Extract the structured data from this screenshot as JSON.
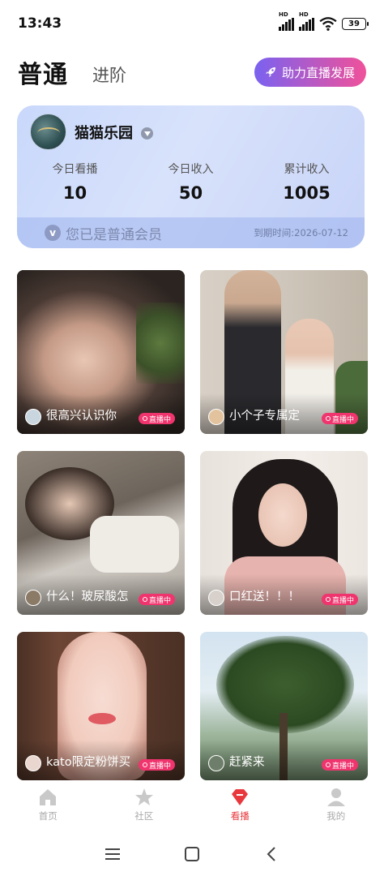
{
  "status_bar": {
    "time": "13:43",
    "battery": "39",
    "signal_label": "HD"
  },
  "header": {
    "tab_primary": "普通",
    "tab_secondary": "进阶",
    "boost_button": "助力直播发展"
  },
  "member_card": {
    "username": "猫猫乐园",
    "stats": [
      {
        "label": "今日看播",
        "value": "10"
      },
      {
        "label": "今日收入",
        "value": "50"
      },
      {
        "label": "累计收入",
        "value": "1005"
      }
    ],
    "member_status": "您已是普通会员",
    "member_icon_letter": "v",
    "expire_text": "到期时间:2026-07-12"
  },
  "live_badge_label": "直播中",
  "streams": [
    {
      "title": "很高兴认识你",
      "live": "直播中"
    },
    {
      "title": "小个子专属定",
      "live": "直播中"
    },
    {
      "title": "什么！玻尿酸怎",
      "live": "直播中"
    },
    {
      "title": "口红送！！！",
      "live": "直播中"
    },
    {
      "title": "kato限定粉饼买",
      "live": "直播中"
    },
    {
      "title": "赶紧来",
      "live": "直播中"
    }
  ],
  "bottom_nav": [
    {
      "label": "首页",
      "icon": "home-icon"
    },
    {
      "label": "社区",
      "icon": "star-icon"
    },
    {
      "label": "看播",
      "icon": "live-gem-icon",
      "active": true
    },
    {
      "label": "我的",
      "icon": "profile-icon"
    }
  ],
  "colors": {
    "accent": "#e8383d",
    "boost_gradient_start": "#7a62f0",
    "boost_gradient_end": "#f0519a",
    "live_badge": "#f0346e",
    "card_bg": "#d2ddfa"
  }
}
